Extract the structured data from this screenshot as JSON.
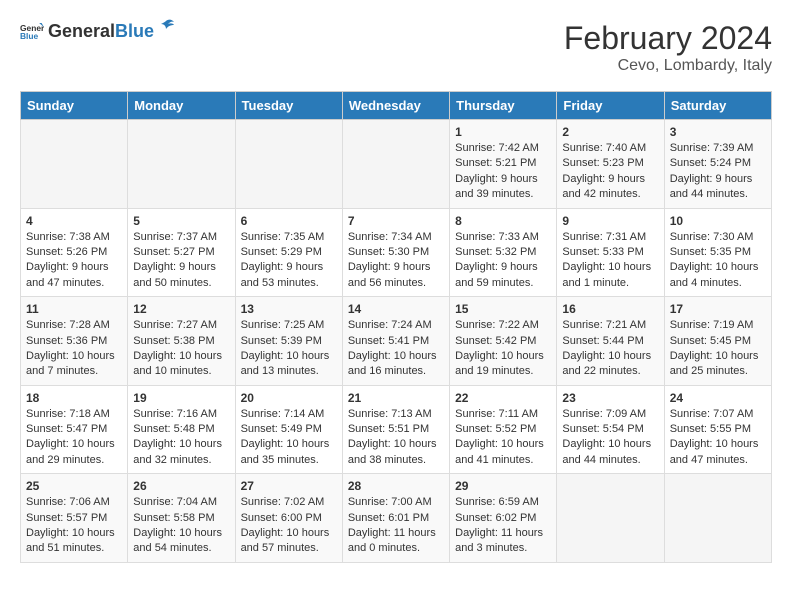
{
  "header": {
    "logo_general": "General",
    "logo_blue": "Blue",
    "title": "February 2024",
    "subtitle": "Cevo, Lombardy, Italy"
  },
  "calendar": {
    "days_of_week": [
      "Sunday",
      "Monday",
      "Tuesday",
      "Wednesday",
      "Thursday",
      "Friday",
      "Saturday"
    ],
    "weeks": [
      [
        {
          "day": "",
          "info": ""
        },
        {
          "day": "",
          "info": ""
        },
        {
          "day": "",
          "info": ""
        },
        {
          "day": "",
          "info": ""
        },
        {
          "day": "1",
          "info": "Sunrise: 7:42 AM\nSunset: 5:21 PM\nDaylight: 9 hours\nand 39 minutes."
        },
        {
          "day": "2",
          "info": "Sunrise: 7:40 AM\nSunset: 5:23 PM\nDaylight: 9 hours\nand 42 minutes."
        },
        {
          "day": "3",
          "info": "Sunrise: 7:39 AM\nSunset: 5:24 PM\nDaylight: 9 hours\nand 44 minutes."
        }
      ],
      [
        {
          "day": "4",
          "info": "Sunrise: 7:38 AM\nSunset: 5:26 PM\nDaylight: 9 hours\nand 47 minutes."
        },
        {
          "day": "5",
          "info": "Sunrise: 7:37 AM\nSunset: 5:27 PM\nDaylight: 9 hours\nand 50 minutes."
        },
        {
          "day": "6",
          "info": "Sunrise: 7:35 AM\nSunset: 5:29 PM\nDaylight: 9 hours\nand 53 minutes."
        },
        {
          "day": "7",
          "info": "Sunrise: 7:34 AM\nSunset: 5:30 PM\nDaylight: 9 hours\nand 56 minutes."
        },
        {
          "day": "8",
          "info": "Sunrise: 7:33 AM\nSunset: 5:32 PM\nDaylight: 9 hours\nand 59 minutes."
        },
        {
          "day": "9",
          "info": "Sunrise: 7:31 AM\nSunset: 5:33 PM\nDaylight: 10 hours\nand 1 minute."
        },
        {
          "day": "10",
          "info": "Sunrise: 7:30 AM\nSunset: 5:35 PM\nDaylight: 10 hours\nand 4 minutes."
        }
      ],
      [
        {
          "day": "11",
          "info": "Sunrise: 7:28 AM\nSunset: 5:36 PM\nDaylight: 10 hours\nand 7 minutes."
        },
        {
          "day": "12",
          "info": "Sunrise: 7:27 AM\nSunset: 5:38 PM\nDaylight: 10 hours\nand 10 minutes."
        },
        {
          "day": "13",
          "info": "Sunrise: 7:25 AM\nSunset: 5:39 PM\nDaylight: 10 hours\nand 13 minutes."
        },
        {
          "day": "14",
          "info": "Sunrise: 7:24 AM\nSunset: 5:41 PM\nDaylight: 10 hours\nand 16 minutes."
        },
        {
          "day": "15",
          "info": "Sunrise: 7:22 AM\nSunset: 5:42 PM\nDaylight: 10 hours\nand 19 minutes."
        },
        {
          "day": "16",
          "info": "Sunrise: 7:21 AM\nSunset: 5:44 PM\nDaylight: 10 hours\nand 22 minutes."
        },
        {
          "day": "17",
          "info": "Sunrise: 7:19 AM\nSunset: 5:45 PM\nDaylight: 10 hours\nand 25 minutes."
        }
      ],
      [
        {
          "day": "18",
          "info": "Sunrise: 7:18 AM\nSunset: 5:47 PM\nDaylight: 10 hours\nand 29 minutes."
        },
        {
          "day": "19",
          "info": "Sunrise: 7:16 AM\nSunset: 5:48 PM\nDaylight: 10 hours\nand 32 minutes."
        },
        {
          "day": "20",
          "info": "Sunrise: 7:14 AM\nSunset: 5:49 PM\nDaylight: 10 hours\nand 35 minutes."
        },
        {
          "day": "21",
          "info": "Sunrise: 7:13 AM\nSunset: 5:51 PM\nDaylight: 10 hours\nand 38 minutes."
        },
        {
          "day": "22",
          "info": "Sunrise: 7:11 AM\nSunset: 5:52 PM\nDaylight: 10 hours\nand 41 minutes."
        },
        {
          "day": "23",
          "info": "Sunrise: 7:09 AM\nSunset: 5:54 PM\nDaylight: 10 hours\nand 44 minutes."
        },
        {
          "day": "24",
          "info": "Sunrise: 7:07 AM\nSunset: 5:55 PM\nDaylight: 10 hours\nand 47 minutes."
        }
      ],
      [
        {
          "day": "25",
          "info": "Sunrise: 7:06 AM\nSunset: 5:57 PM\nDaylight: 10 hours\nand 51 minutes."
        },
        {
          "day": "26",
          "info": "Sunrise: 7:04 AM\nSunset: 5:58 PM\nDaylight: 10 hours\nand 54 minutes."
        },
        {
          "day": "27",
          "info": "Sunrise: 7:02 AM\nSunset: 6:00 PM\nDaylight: 10 hours\nand 57 minutes."
        },
        {
          "day": "28",
          "info": "Sunrise: 7:00 AM\nSunset: 6:01 PM\nDaylight: 11 hours\nand 0 minutes."
        },
        {
          "day": "29",
          "info": "Sunrise: 6:59 AM\nSunset: 6:02 PM\nDaylight: 11 hours\nand 3 minutes."
        },
        {
          "day": "",
          "info": ""
        },
        {
          "day": "",
          "info": ""
        }
      ]
    ]
  }
}
